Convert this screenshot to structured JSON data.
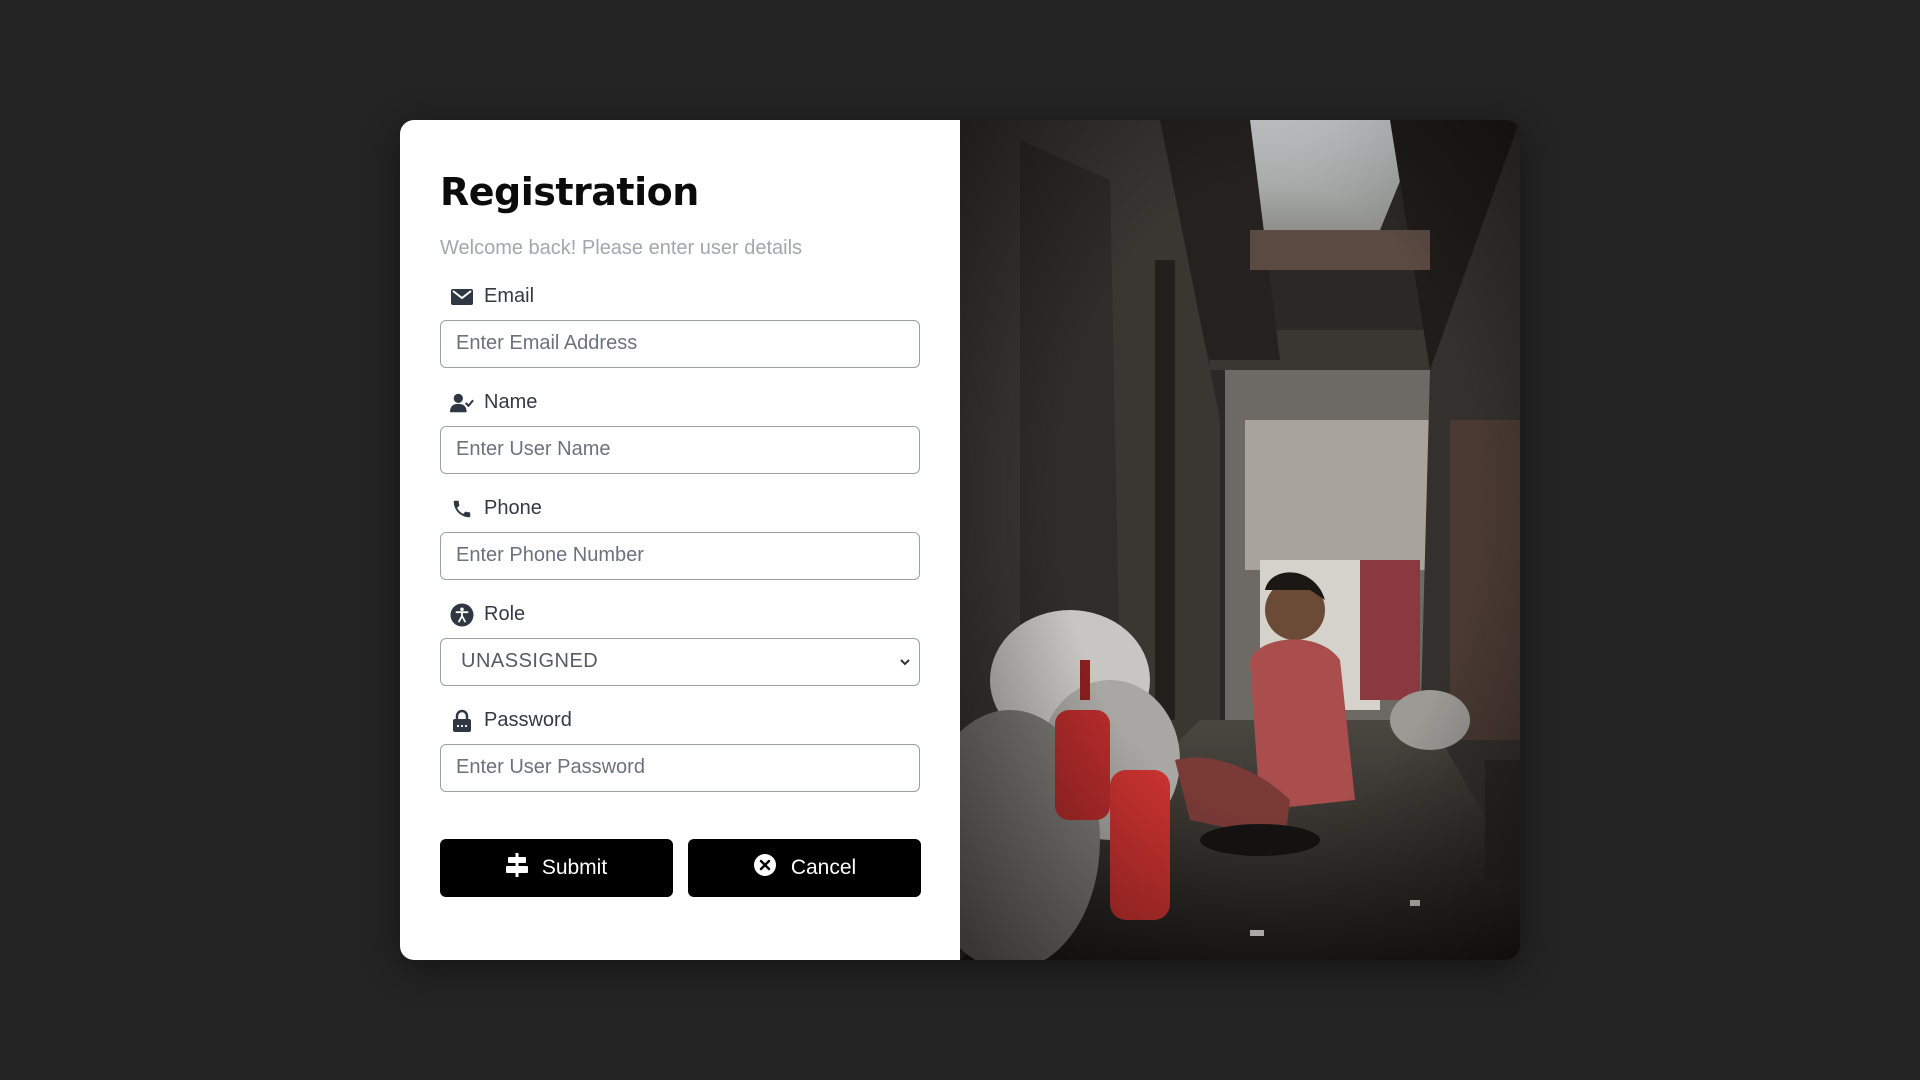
{
  "form": {
    "title": "Registration",
    "subtitle": "Welcome back! Please enter user details",
    "fields": [
      {
        "label": "Email",
        "placeholder": "Enter Email Address",
        "icon": "envelope-icon"
      },
      {
        "label": "Name",
        "placeholder": "Enter User Name",
        "icon": "user-check-icon"
      },
      {
        "label": "Phone",
        "placeholder": "Enter Phone Number",
        "icon": "phone-icon"
      },
      {
        "label": "Role",
        "value": "UNASSIGNED",
        "icon": "accessibility-icon"
      },
      {
        "label": "Password",
        "placeholder": "Enter User Password",
        "icon": "lock-icon"
      }
    ],
    "submit_label": "Submit",
    "cancel_label": "Cancel"
  },
  "colors": {
    "backdrop": "#242424",
    "panel": "#ffffff",
    "button": "#000000",
    "subtitle": "#a3a6ad"
  }
}
